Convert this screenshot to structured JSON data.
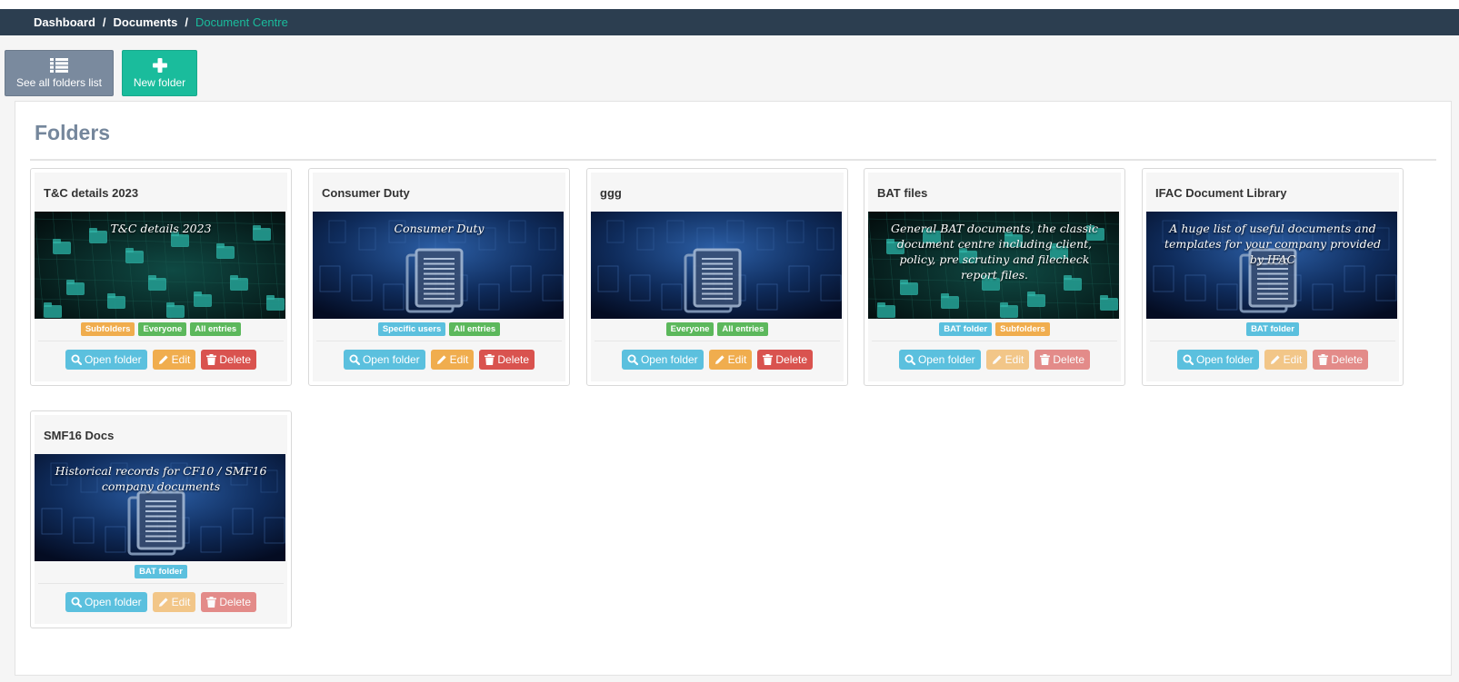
{
  "breadcrumb": {
    "items": [
      "Dashboard",
      "Documents"
    ],
    "active": "Document Centre",
    "separator": "/"
  },
  "toolbar": {
    "see_all_label": "See all folders list",
    "new_folder_label": "New folder"
  },
  "panel": {
    "title": "Folders"
  },
  "actions": {
    "open_label": "Open folder",
    "edit_label": "Edit",
    "delete_label": "Delete"
  },
  "colors": {
    "header_bg": "#2c3e50",
    "accent_teal": "#1abc9c",
    "info": "#5bc0de",
    "warning": "#f0ad4e",
    "danger": "#d9534f",
    "success": "#5cb85c"
  },
  "folders": [
    {
      "title": "T&C details 2023",
      "caption": "T&C details 2023",
      "image": "green-folders-network",
      "tags": [
        [
          "Subfolders",
          "orange"
        ],
        [
          "Everyone",
          "green"
        ],
        [
          "All entries",
          "green"
        ]
      ],
      "editable": true
    },
    {
      "title": "Consumer Duty",
      "caption": "Consumer Duty",
      "image": "blue-documents",
      "tags": [
        [
          "Specific users",
          "blue"
        ],
        [
          "All entries",
          "green"
        ]
      ],
      "editable": true
    },
    {
      "title": "ggg",
      "caption": "",
      "image": "blue-documents",
      "tags": [
        [
          "Everyone",
          "green"
        ],
        [
          "All entries",
          "green"
        ]
      ],
      "editable": true
    },
    {
      "title": "BAT files",
      "caption": "General BAT documents, the classic document centre including client, policy, pre scrutiny and filecheck report files.",
      "image": "green-folders-network",
      "tags": [
        [
          "BAT folder",
          "blue"
        ],
        [
          "Subfolders",
          "orange"
        ]
      ],
      "editable": false
    },
    {
      "title": "IFAC Document Library",
      "caption": "A huge list of useful documents and templates for your company provided by IFAC",
      "image": "blue-documents",
      "tags": [
        [
          "BAT folder",
          "blue"
        ]
      ],
      "editable": false
    },
    {
      "title": "SMF16 Docs",
      "caption": "Historical records for CF10 / SMF16 company documents",
      "image": "blue-documents",
      "tags": [
        [
          "BAT folder",
          "blue"
        ]
      ],
      "editable": false
    }
  ]
}
